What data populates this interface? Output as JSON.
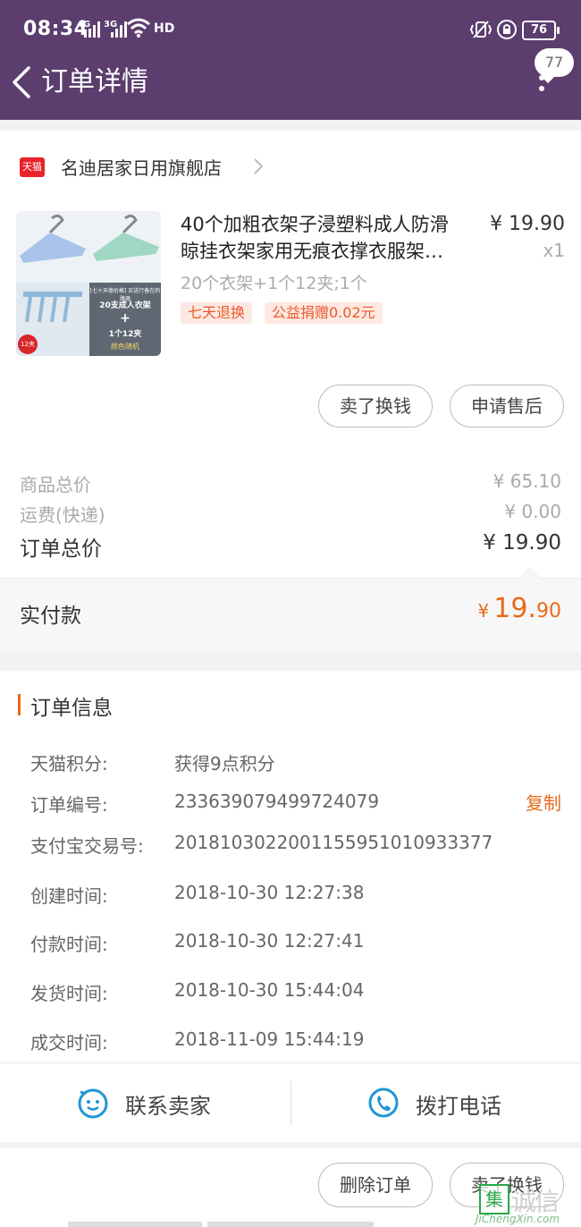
{
  "status_bar": {
    "time": "08:34",
    "network1": "4G",
    "network2": "3G",
    "hd": "HD",
    "battery": "76"
  },
  "header": {
    "title": "订单详情",
    "badge_count": "77",
    "bg_color": "#5b3d6e"
  },
  "shop": {
    "logo_text": "天猫",
    "name": "名迪居家日用旗舰店"
  },
  "product": {
    "title_line1": "40个加粗衣架子浸塑料成人防滑",
    "title_line2": "晾挂衣架家用无痕衣撑衣服架…",
    "price": "¥ 19.90",
    "qty": "x1",
    "sku": "20个衣架+1个12夹;1个",
    "tags": [
      "七天退换",
      "公益捐赠0.02元"
    ],
    "thumb_text": {
      "banner": "[七十天德价格] 买送行备在的路器",
      "line1": "20支成人衣架",
      "plus": "+",
      "line2": "1个12夹",
      "line3": "颜色随机",
      "corner": "12夹"
    }
  },
  "actions": {
    "sell": "卖了换钱",
    "after_sale": "申请售后"
  },
  "summary": {
    "goods_total_label": "商品总价",
    "goods_total": "¥ 65.10",
    "shipping_label": "运费(快递)",
    "shipping": "¥ 0.00",
    "order_total_label": "订单总价",
    "order_total": "¥ 19.90",
    "paid_label": "实付款",
    "paid_symbol": "¥",
    "paid_int": "19.",
    "paid_dec": "90",
    "accent": "#ea6a1a"
  },
  "order_info": {
    "title": "订单信息",
    "copy": "复制",
    "rows": [
      {
        "label": "天猫积分:",
        "value": "获得9点积分"
      },
      {
        "label": "订单编号:",
        "value": "233639079499724079"
      },
      {
        "label": "支付宝交易号:",
        "value": "2018103022001155951010933377"
      },
      {
        "label": "创建时间:",
        "value": "2018-10-30 12:27:38"
      },
      {
        "label": "付款时间:",
        "value": "2018-10-30 12:27:41"
      },
      {
        "label": "发货时间:",
        "value": "2018-10-30 15:44:04"
      },
      {
        "label": "成交时间:",
        "value": "2018-11-09 15:44:19"
      }
    ]
  },
  "contact": {
    "seller": "联系卖家",
    "phone": "拨打电话",
    "icon_color": "#2196d3"
  },
  "footer": {
    "delete": "删除订单",
    "sell": "卖了换钱"
  },
  "watermark": {
    "box": "集",
    "cn": "诚信",
    "en": "JiChengXin.com"
  }
}
